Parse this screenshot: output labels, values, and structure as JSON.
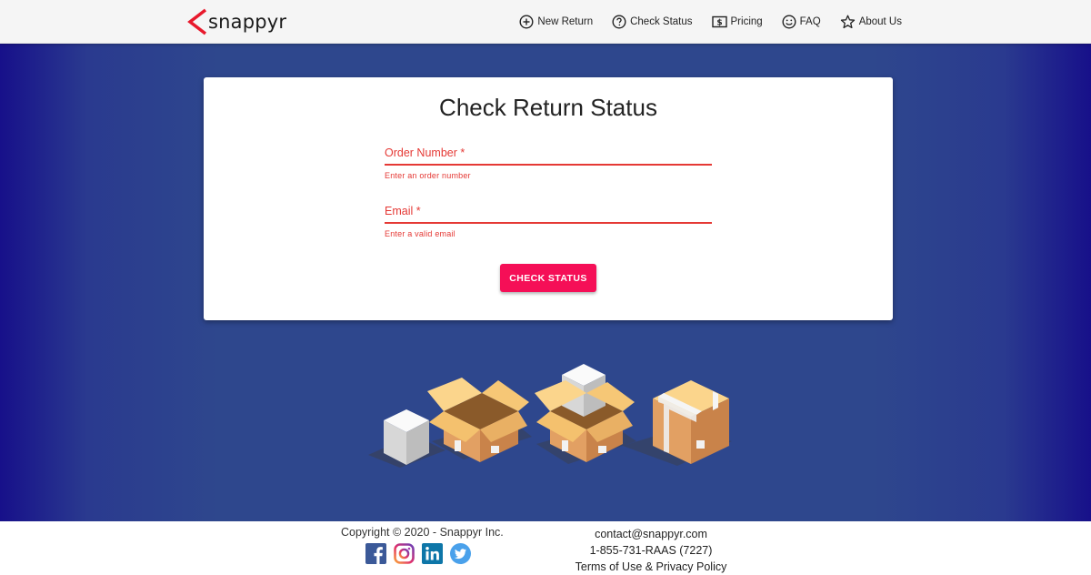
{
  "brand": {
    "name": "snappyr",
    "accent": "#e8192c"
  },
  "nav": {
    "items": [
      {
        "label": "New Return",
        "icon": "plus-circle-icon"
      },
      {
        "label": "Check Status",
        "icon": "question-circle-icon"
      },
      {
        "label": "Pricing",
        "icon": "dollar-bill-icon"
      },
      {
        "label": "FAQ",
        "icon": "smiley-icon"
      },
      {
        "label": "About Us",
        "icon": "star-icon"
      }
    ]
  },
  "form": {
    "title": "Check Return Status",
    "order_number": {
      "label": "Order Number *",
      "value": "",
      "error": "Enter an order number"
    },
    "email": {
      "label": "Email *",
      "value": "",
      "error": "Enter a valid email"
    },
    "submit_label": "CHECK STATUS",
    "error_color": "#e53935",
    "button_color": "#f50f57"
  },
  "footer": {
    "copyright": "Copyright © 2020 - Snappyr Inc.",
    "social": [
      "facebook-icon",
      "instagram-icon",
      "linkedin-icon",
      "twitter-icon"
    ],
    "email": "contact@snappyr.com",
    "phone": "1-855-731-RAAS (7227)",
    "terms": "Terms of Use & Privacy Policy"
  },
  "colors": {
    "hero_center": "#2e478d",
    "hero_edge": "#17108a"
  }
}
